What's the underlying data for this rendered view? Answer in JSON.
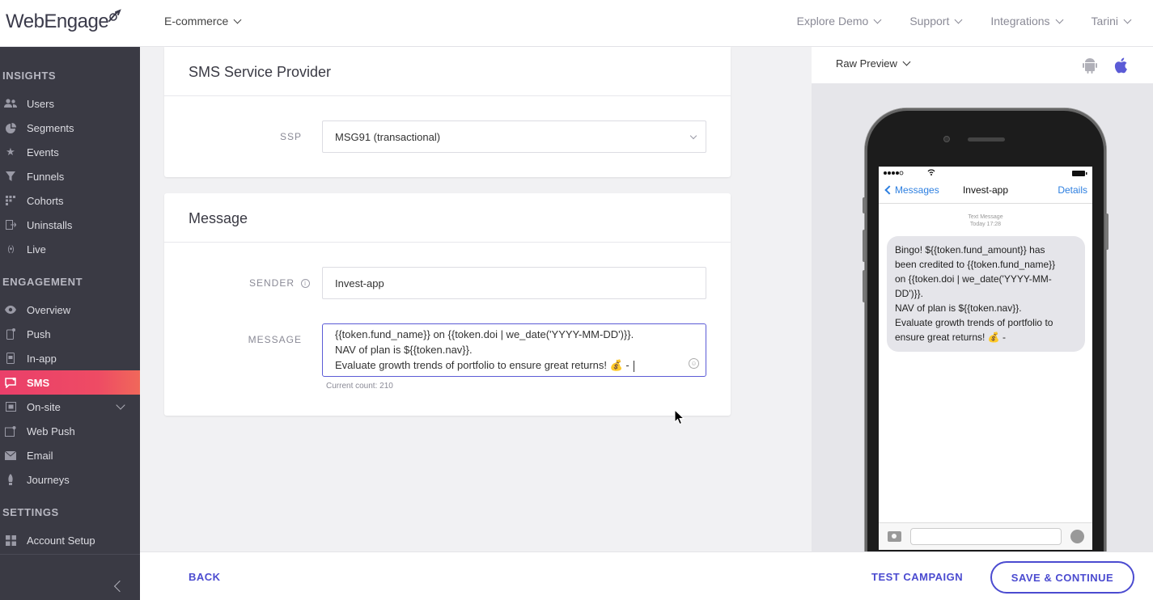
{
  "header": {
    "logo": "WebEngage",
    "workspace": "E-commerce",
    "nav": [
      "Explore Demo",
      "Support",
      "Integrations",
      "Tarini"
    ]
  },
  "sidebar": {
    "insights_title": "INSIGHTS",
    "insights": [
      {
        "label": "Users",
        "icon": "users-icon"
      },
      {
        "label": "Segments",
        "icon": "pie-chart-icon"
      },
      {
        "label": "Events",
        "icon": "star-icon"
      },
      {
        "label": "Funnels",
        "icon": "funnel-icon"
      },
      {
        "label": "Cohorts",
        "icon": "grid-icon"
      },
      {
        "label": "Uninstalls",
        "icon": "uninstall-icon"
      },
      {
        "label": "Live",
        "icon": "live-icon"
      }
    ],
    "engagement_title": "ENGAGEMENT",
    "engagement": [
      {
        "label": "Overview",
        "icon": "eye-icon"
      },
      {
        "label": "Push",
        "icon": "push-icon"
      },
      {
        "label": "In-app",
        "icon": "in-app-icon"
      },
      {
        "label": "SMS",
        "icon": "sms-icon",
        "active": true
      },
      {
        "label": "On-site",
        "icon": "on-site-icon"
      },
      {
        "label": "Web Push",
        "icon": "web-push-icon"
      },
      {
        "label": "Email",
        "icon": "email-icon"
      },
      {
        "label": "Journeys",
        "icon": "journeys-icon"
      }
    ],
    "settings_title": "SETTINGS",
    "settings": [
      {
        "label": "Account Setup",
        "icon": "account-setup-icon"
      }
    ]
  },
  "ssp_card": {
    "title": "SMS Service Provider",
    "label": "SSP",
    "value": "MSG91 (transactional)"
  },
  "message_card": {
    "title": "Message",
    "sender_label": "SENDER",
    "sender_value": "Invest-app",
    "message_label": "MESSAGE",
    "message_lines": [
      "{{token.fund_name}} on {{token.doi | we_date('YYYY-MM-DD')}}.",
      "NAV of plan is ${{token.nav}}.",
      "Evaluate growth trends of portfolio to ensure great returns! 💰 - "
    ],
    "count": "Current count: 210"
  },
  "preview": {
    "title": "Raw Preview",
    "back": "Messages",
    "contact": "Invest-app",
    "details": "Details",
    "meta_line1": "Text Message",
    "meta_line2": "Today 17:28",
    "bubble": [
      "Bingo! ${{token.fund_amount}} has",
      "been credited to {{token.fund_name}}",
      "on {{token.doi | we_date('YYYY-MM-",
      "DD')}}.",
      "NAV of plan is ${{token.nav}}.",
      "Evaluate growth trends of portfolio to",
      "ensure great returns! 💰 -"
    ]
  },
  "footer": {
    "back": "BACK",
    "test": "TEST CAMPAIGN",
    "save": "SAVE & CONTINUE"
  },
  "colors": {
    "accent": "#4b4bd0",
    "active": "#ea3f6a",
    "sidebar": "#3a3a44"
  }
}
